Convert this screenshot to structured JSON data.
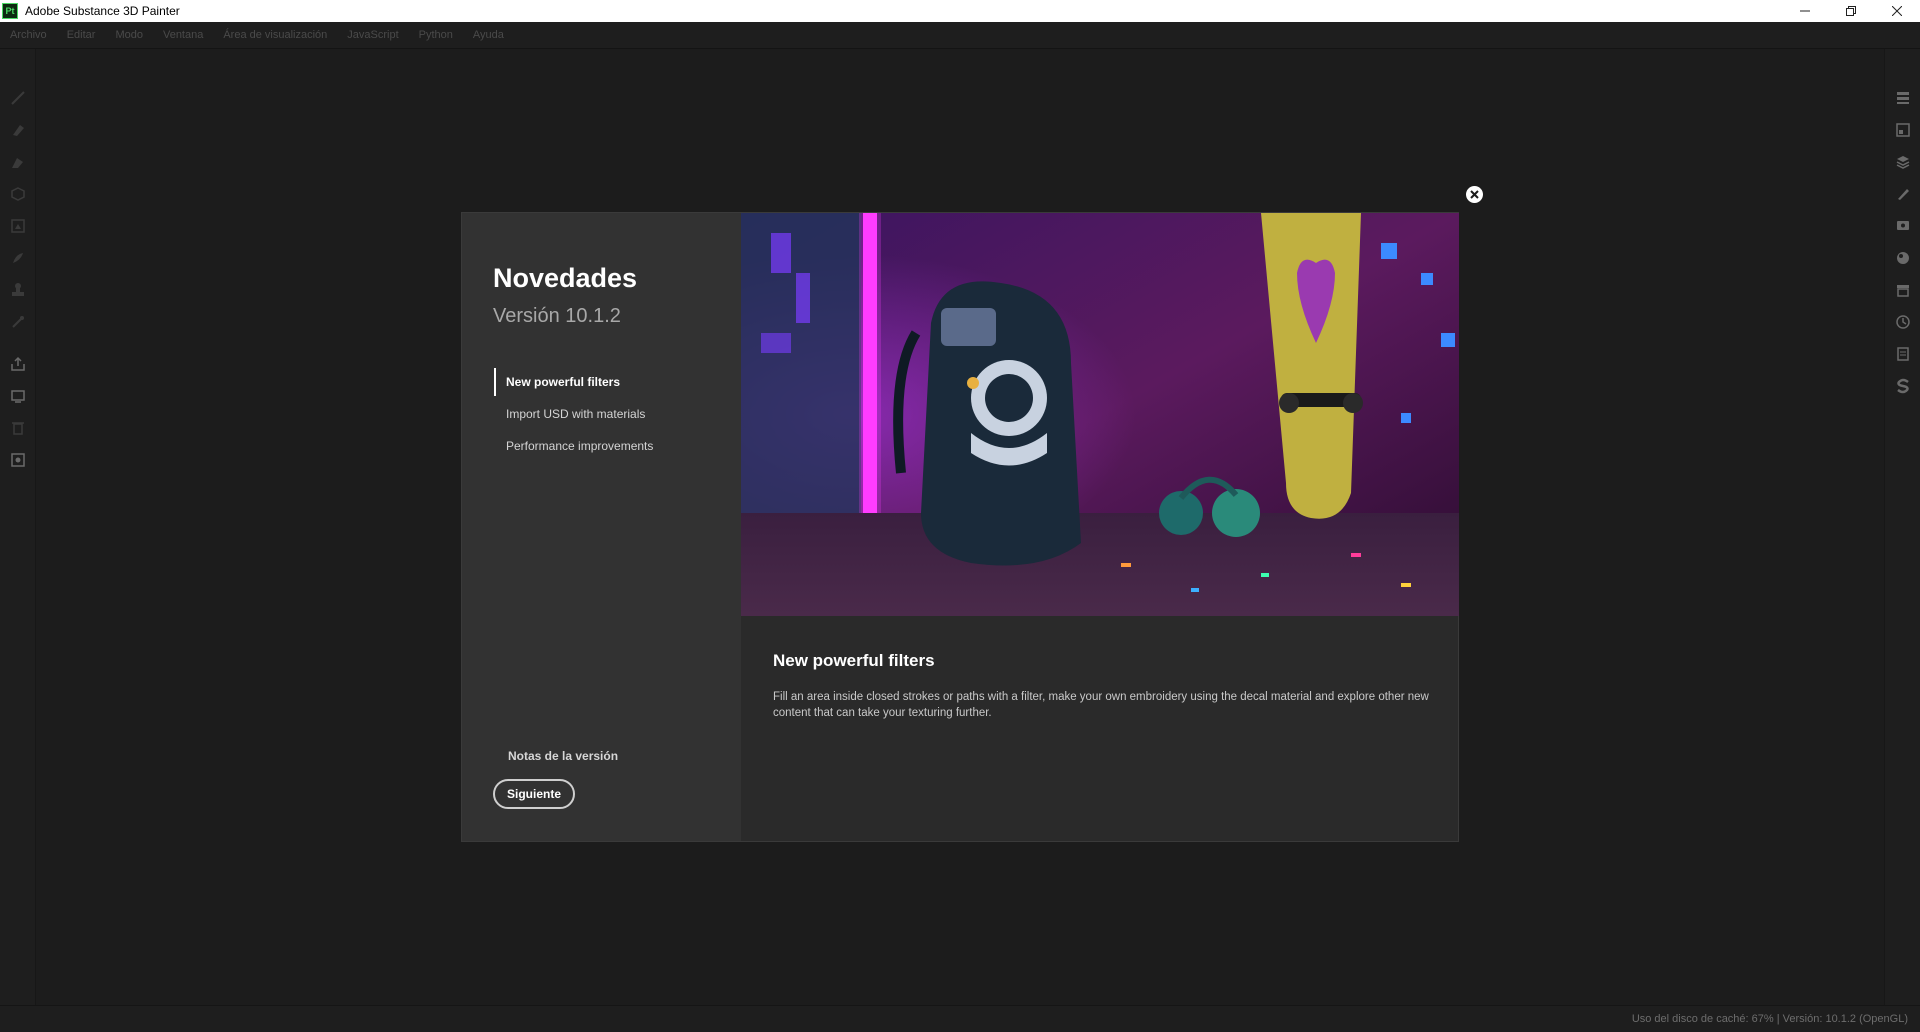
{
  "window": {
    "app_logo": "Pt",
    "title": "Adobe Substance 3D Painter",
    "controls": [
      "minimize-icon",
      "restore-icon",
      "close-icon"
    ]
  },
  "menu": {
    "items": [
      "Archivo",
      "Editar",
      "Modo",
      "Ventana",
      "Área de visualización",
      "JavaScript",
      "Python",
      "Ayuda"
    ]
  },
  "left_toolbar": {
    "icons": [
      "paint-brush-icon",
      "eraser-icon",
      "projection-icon",
      "geometry-fill-icon",
      "polygon-fill-icon",
      "smudge-icon",
      "clone-stamp-icon",
      "color-picker-icon",
      "export-icon",
      "bake-icon",
      "delete-icon",
      "screenshot-icon"
    ]
  },
  "right_toolbar": {
    "icons": [
      "texture-set-list-icon",
      "texture-set-settings-icon",
      "layers-icon",
      "properties-icon",
      "display-settings-icon",
      "shader-settings-icon",
      "assets-icon",
      "history-icon",
      "log-icon",
      "substance-icon"
    ]
  },
  "dialog": {
    "title": "Novedades",
    "version": "Versión 10.1.2",
    "nav": [
      {
        "label": "New powerful filters",
        "active": true
      },
      {
        "label": "Import USD with materials",
        "active": false
      },
      {
        "label": "Performance improvements",
        "active": false
      }
    ],
    "release_notes": "Notas de la versión",
    "next_button": "Siguiente",
    "content_title": "New powerful filters",
    "content_description": "Fill an area inside closed strokes or paths with a filter, make your own embroidery using the decal material and explore other new content that can take your texturing further."
  },
  "status": {
    "text": "Uso del disco de caché:   67% | Versión: 10.1.2 (OpenGL)"
  }
}
